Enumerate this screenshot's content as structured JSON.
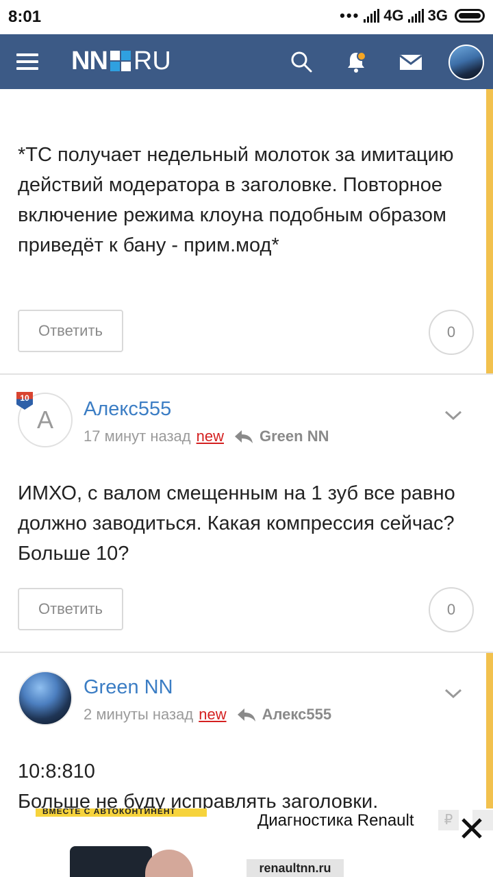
{
  "status_bar": {
    "time": "8:01",
    "dots": "•••",
    "net1": "4G",
    "net2": "3G"
  },
  "header": {
    "logo_nn": "NN",
    "logo_ru": "RU",
    "notification_dot_color": "#f5a623",
    "bg_color": "#3c5a86"
  },
  "posts": [
    {
      "text": "*ТС получает недельный молоток за имитацию действий модератора в заголовке. Повторное включение режима клоуна подобным образом приведёт к бану - прим.мод*",
      "reply_label": "Ответить",
      "count": "0"
    },
    {
      "author": "Алекс555",
      "avatar_letter": "А",
      "badge": "10",
      "time": "17 минут назад",
      "new_label": "new",
      "reply_to": "Green NN",
      "text": "ИМХО, с валом смещенным на 1 зуб все равно должно заводиться. Какая компрессия сейчас? Больше 10?",
      "reply_label": "Ответить",
      "count": "0"
    },
    {
      "author": "Green NN",
      "time": "2 минуты назад",
      "new_label": "new",
      "reply_to": "Алекс555",
      "text_line1": "10:8:810",
      "text_line2": "Больше не буду исправлять заголовки."
    }
  ],
  "ad": {
    "strip_text": "ВМЕСТЕ С АВТОКОНТИНЕНТ",
    "title": "Диагностика Renault",
    "domain": "renaultnn.ru",
    "currency": "₽"
  }
}
